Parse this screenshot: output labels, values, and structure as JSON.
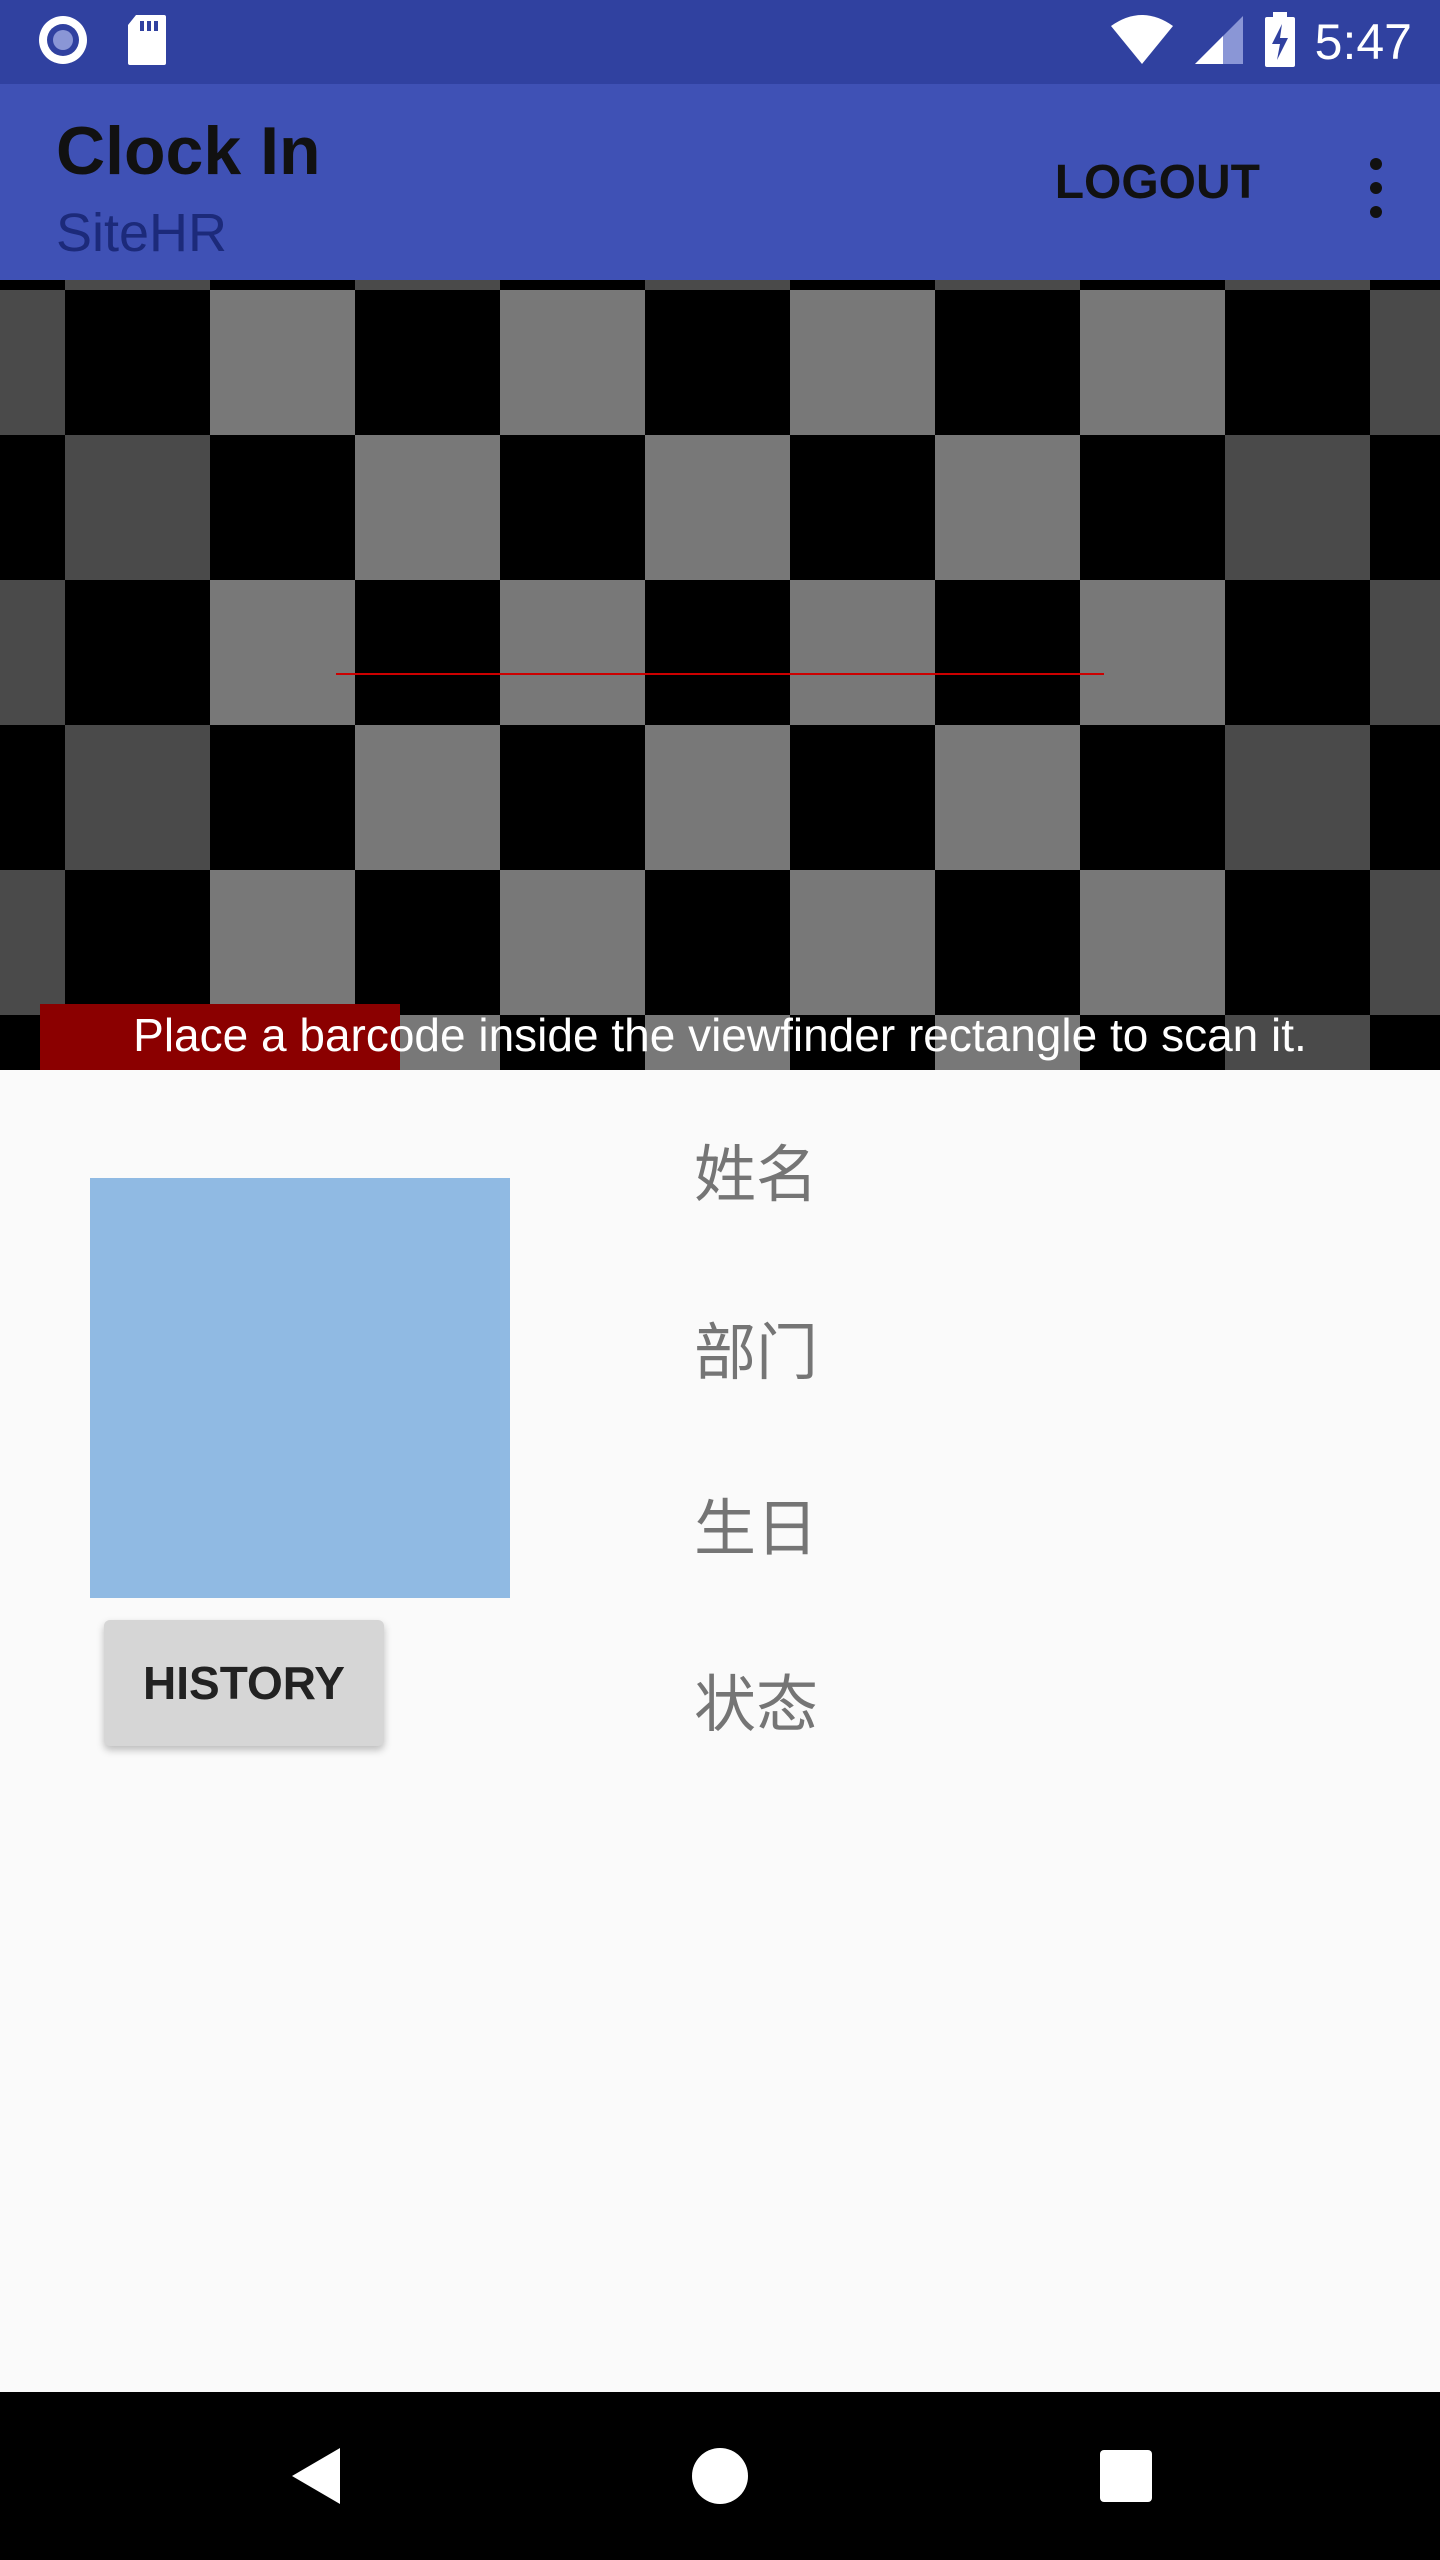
{
  "status_bar": {
    "time": "5:47",
    "icons": [
      "notification-circle-icon",
      "sd-card-icon",
      "wifi-icon",
      "cell-signal-icon",
      "battery-charging-icon"
    ]
  },
  "app_bar": {
    "title": "Clock In",
    "subtitle": "SiteHR",
    "logout_label": "LOGOUT",
    "overflow_icon": "more-vert-icon",
    "color": "#3f51b5",
    "status_color": "#3041a0"
  },
  "scanner": {
    "hint": "Place a barcode inside the viewfinder rectangle to scan it.",
    "laser_color": "#cc0000"
  },
  "employee": {
    "photo_color": "#90bae3",
    "history_label": "HISTORY",
    "name_label": "姓名",
    "department_label": "部门",
    "birthday_label": "生日",
    "status_label": "状态"
  },
  "nav_bar": {
    "back_icon": "back-triangle-icon",
    "home_icon": "home-circle-icon",
    "recents_icon": "recents-square-icon"
  }
}
